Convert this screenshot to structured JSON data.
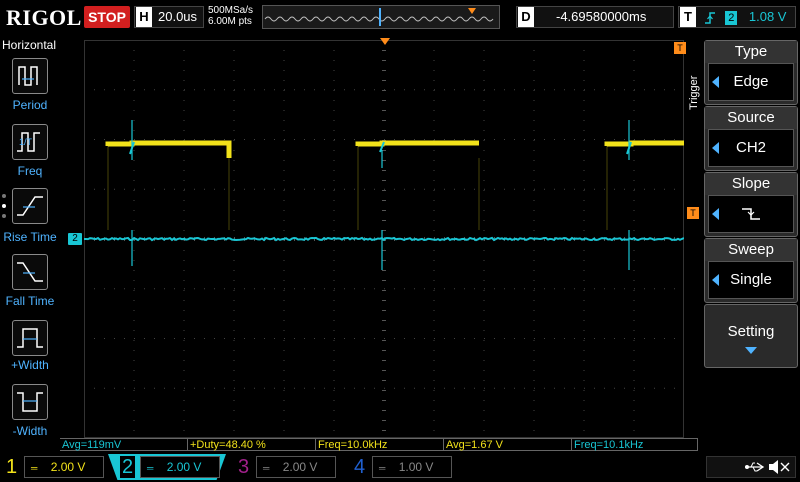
{
  "topbar": {
    "brand": "RIGOL",
    "run_state": "STOP",
    "horizontal_label": "H",
    "timebase": "20.0us",
    "sample_rate": "500MSa/s",
    "memory_depth": "6.00M pts",
    "delay_label": "D",
    "delay_value": "-4.69580000ms",
    "trigger_label": "T",
    "trigger_source_num": "2",
    "trigger_level": "1.08 V"
  },
  "left_menu": {
    "title": "Horizontal",
    "items": [
      {
        "label": "Period",
        "icon": "period-icon"
      },
      {
        "label": "Freq",
        "icon": "frequency-icon"
      },
      {
        "label": "Rise Time",
        "icon": "rise-time-icon"
      },
      {
        "label": "Fall Time",
        "icon": "fall-time-icon"
      },
      {
        "label": "+Width",
        "icon": "positive-width-icon"
      },
      {
        "label": "-Width",
        "icon": "negative-width-icon"
      }
    ]
  },
  "right_menu": {
    "side_label": "Trigger",
    "items": [
      {
        "header": "Type",
        "value": "Edge"
      },
      {
        "header": "Source",
        "value": "CH2"
      },
      {
        "header": "Slope",
        "value": ""
      },
      {
        "header": "Sweep",
        "value": "Single"
      },
      {
        "header": "Setting",
        "value": ""
      }
    ]
  },
  "markers": {
    "ch2": "2",
    "trigger": "T"
  },
  "measurements": [
    {
      "text": "Avg=119mV",
      "color": "#19c6d4"
    },
    {
      "text": "+Duty=48.40 %",
      "color": "#f2e21a"
    },
    {
      "text": "Freq=10.0kHz",
      "color": "#f2e21a"
    },
    {
      "text": "Avg=1.67 V",
      "color": "#f2e21a"
    },
    {
      "text": "Freq=10.1kHz",
      "color": "#19c6d4"
    }
  ],
  "channels": [
    {
      "num": "1",
      "scale": "2.00 V",
      "color": "#f2e21a",
      "active": true
    },
    {
      "num": "2",
      "scale": "2.00 V",
      "color": "#19c6d4",
      "active": true
    },
    {
      "num": "3",
      "scale": "2.00 V",
      "color": "#a0208a",
      "active": false
    },
    {
      "num": "4",
      "scale": "1.00 V",
      "color": "#2060d0",
      "active": false
    }
  ],
  "colors": {
    "ch1": "#f2e21a",
    "ch2": "#19c6d4",
    "trigger": "#ff8c1a",
    "accent": "#4fb3ff",
    "stop": "#d21f1f"
  }
}
